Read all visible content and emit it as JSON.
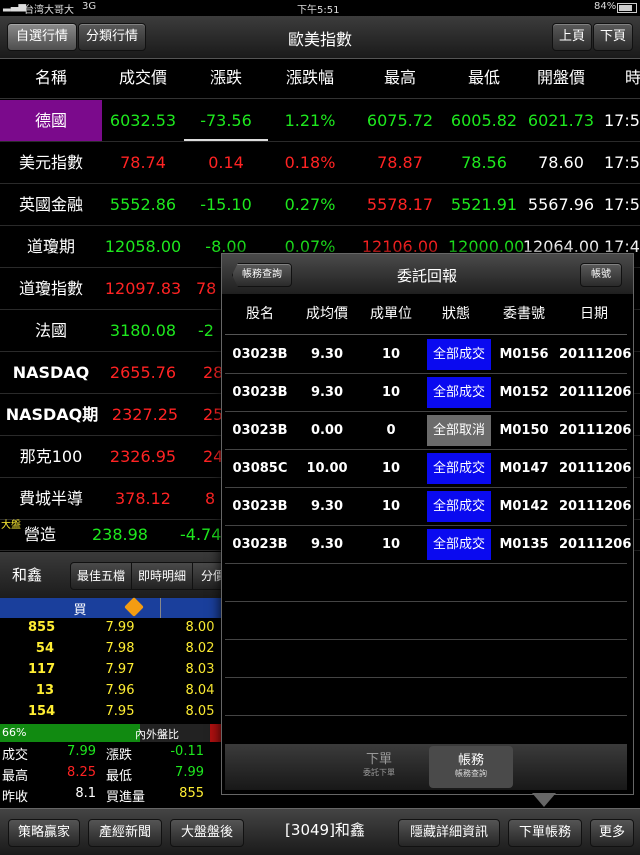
{
  "status_bar": {
    "carrier": "台湾大哥大",
    "network": "3G",
    "time": "下午5:51",
    "battery": "84%"
  },
  "nav": {
    "tab_watchlist": "自選行情",
    "tab_category": "分類行情",
    "title": "歐美指數",
    "prev_page": "上頁",
    "next_page": "下頁"
  },
  "quotes": {
    "headers": [
      "名稱",
      "成交價",
      "漲跌",
      "漲跌幅",
      "最高",
      "最低",
      "開盤價",
      "時"
    ],
    "rows": [
      {
        "name": "德國",
        "price": "6032.53",
        "change": "-73.56",
        "pct": "1.21%",
        "high": "6075.72",
        "low": "6005.82",
        "open": "6021.73",
        "time": "17:5"
      },
      {
        "name": "美元指數",
        "price": "78.74",
        "change": "0.14",
        "pct": "0.18%",
        "high": "78.87",
        "low": "78.56",
        "open": "78.60",
        "time": "17:5"
      },
      {
        "name": "英國金融",
        "price": "5552.86",
        "change": "-15.10",
        "pct": "0.27%",
        "high": "5578.17",
        "low": "5521.91",
        "open": "5567.96",
        "time": "17:5"
      },
      {
        "name": "道瓊期",
        "price": "12058.00",
        "change": "-8.00",
        "pct": "0.07%",
        "high": "12106.00",
        "low": "12000.00",
        "open": "12064.00",
        "time": "17:4"
      },
      {
        "name": "道瓊指數",
        "price": "12097.83",
        "change": "78",
        "pct": "",
        "high": "",
        "low": "",
        "open": "",
        "time": ""
      },
      {
        "name": "法國",
        "price": "3180.08",
        "change": "-2",
        "pct": "",
        "high": "",
        "low": "",
        "open": "",
        "time": ""
      },
      {
        "name": "NASDAQ",
        "price": "2655.76",
        "change": "28",
        "pct": "",
        "high": "",
        "low": "",
        "open": "",
        "time": ""
      },
      {
        "name": "NASDAQ期",
        "price": "2327.25",
        "change": "25",
        "pct": "",
        "high": "",
        "low": "",
        "open": "",
        "time": ""
      },
      {
        "name": "那克100",
        "price": "2326.95",
        "change": "24",
        "pct": "",
        "high": "",
        "low": "",
        "open": "",
        "time": ""
      },
      {
        "name": "費城半導",
        "price": "378.12",
        "change": "8",
        "pct": "",
        "high": "",
        "low": "",
        "open": "",
        "time": ""
      },
      {
        "name": "營造",
        "price": "238.98",
        "change": "-4.74",
        "pct": "",
        "high": "",
        "low": "",
        "open": "",
        "time": ""
      }
    ],
    "market_tag": "大盤"
  },
  "stock": {
    "name": "和鑫",
    "tab_best5": "最佳五檔",
    "tab_ticks": "即時明細",
    "tab_more": "分價",
    "buy_label": "買",
    "book": [
      {
        "qty": "855",
        "bid": "7.99",
        "ask": "8.00"
      },
      {
        "qty": "54",
        "bid": "7.98",
        "ask": "8.02"
      },
      {
        "qty": "117",
        "bid": "7.97",
        "ask": "8.03"
      },
      {
        "qty": "13",
        "bid": "7.96",
        "ask": "8.04"
      },
      {
        "qty": "154",
        "bid": "7.95",
        "ask": "8.05"
      }
    ],
    "inout_pct": "66%",
    "inout_label": "內外盤比",
    "summary": [
      {
        "l1": "成交",
        "v1": "7.99",
        "l2": "漲跌",
        "v2": "-0.11"
      },
      {
        "l1": "最高",
        "v1": "8.25",
        "l2": "最低",
        "v2": "7.99"
      },
      {
        "l1": "昨收",
        "v1": "8.1",
        "l2": "買進量",
        "v2": "855"
      }
    ]
  },
  "popup": {
    "back_button": "帳務查詢",
    "title": "委託回報",
    "account_button": "帳號",
    "headers": [
      "股名",
      "成均價",
      "成單位",
      "狀態",
      "委書號",
      "日期"
    ],
    "rows": [
      {
        "code": "03023B",
        "avg": "9.30",
        "units": "10",
        "status": "全部成交",
        "order": "M0156",
        "date": "20111206"
      },
      {
        "code": "03023B",
        "avg": "9.30",
        "units": "10",
        "status": "全部成交",
        "order": "M0152",
        "date": "20111206"
      },
      {
        "code": "03023B",
        "avg": "0.00",
        "units": "0",
        "status": "全部取消",
        "order": "M0150",
        "date": "20111206"
      },
      {
        "code": "03085C",
        "avg": "10.00",
        "units": "10",
        "status": "全部成交",
        "order": "M0147",
        "date": "20111206"
      },
      {
        "code": "03023B",
        "avg": "9.30",
        "units": "10",
        "status": "全部成交",
        "order": "M0142",
        "date": "20111206"
      },
      {
        "code": "03023B",
        "avg": "9.30",
        "units": "10",
        "status": "全部成交",
        "order": "M0135",
        "date": "20111206"
      }
    ],
    "footer_tab1": "下單",
    "footer_tab1_sub": "委託下單",
    "footer_tab2": "帳務",
    "footer_tab2_sub": "帳務查詢"
  },
  "bottom": {
    "strategy": "策略贏家",
    "news": "產經新聞",
    "after_market": "大盤盤後",
    "stock_title": "[3049]和鑫",
    "hide_detail": "隱藏詳細資訊",
    "order_account": "下單帳務",
    "more": "更多"
  },
  "colors": {
    "filled": "#0a0af0",
    "cancelled": "#6b6b6b",
    "selected_row": "#7b0a8c",
    "up": "#ff2323",
    "down": "#1ee81e"
  }
}
